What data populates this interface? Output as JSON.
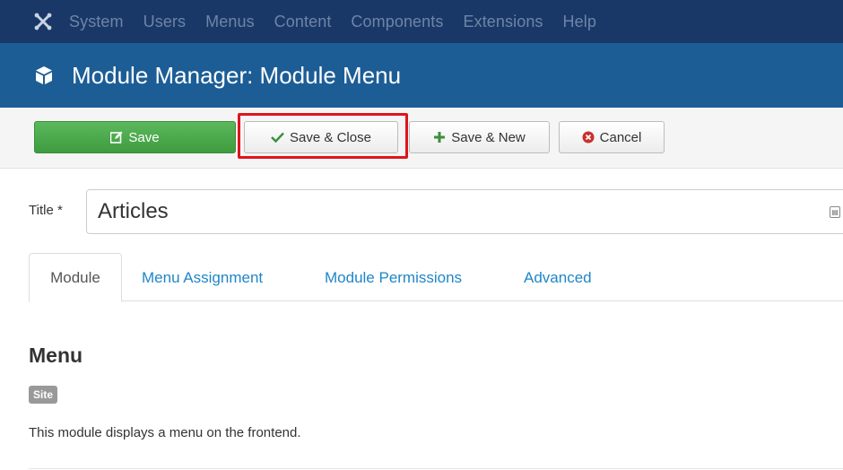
{
  "topbar": {
    "logo_icon": "joomla-logo-icon",
    "menu": [
      "System",
      "Users",
      "Menus",
      "Content",
      "Components",
      "Extensions",
      "Help"
    ]
  },
  "titlebar": {
    "icon": "cube-icon",
    "title": "Module Manager: Module Menu"
  },
  "toolbar": {
    "save_label": "Save",
    "save_close_label": "Save & Close",
    "save_new_label": "Save & New",
    "cancel_label": "Cancel",
    "highlighted_button": "Save & Close",
    "highlight_color": "#e0141c"
  },
  "form": {
    "title_label": "Title *",
    "title_value": "Articles"
  },
  "tabs": {
    "module": "Module",
    "menu_assignment": "Menu Assignment",
    "permissions": "Module Permissions",
    "advanced": "Advanced",
    "active": "Module"
  },
  "module": {
    "heading": "Menu",
    "badge": "Site",
    "description": "This module displays a menu on the frontend."
  },
  "colors": {
    "topbar": "#1a3867",
    "titlebar": "#1c5d96",
    "save_button": "#46a546",
    "link": "#1f86c8"
  }
}
